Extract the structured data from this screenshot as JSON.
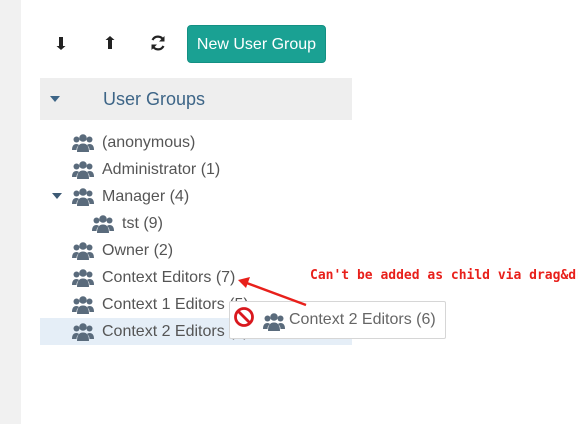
{
  "toolbar": {
    "expand_icon": "arrow-down-icon",
    "collapse_icon": "arrow-up-icon",
    "refresh_icon": "refresh-icon",
    "new_group_label": "New User Group"
  },
  "tree": {
    "root_label": "User Groups",
    "nodes": [
      {
        "label": "(anonymous)"
      },
      {
        "label": "Administrator (1)"
      },
      {
        "label": "Manager (4)"
      },
      {
        "label": "tst (9)"
      },
      {
        "label": "Owner (2)"
      },
      {
        "label": "Context Editors (7)"
      },
      {
        "label": "Context 1 Editors (5)"
      },
      {
        "label": "Context 2 Editors (6)"
      }
    ]
  },
  "drag": {
    "ghost_label": "Context 2 Editors (6)",
    "blocked_icon": "no-entry-icon"
  },
  "annotation": {
    "text": "Can't be added as child via drag&drop"
  },
  "colors": {
    "primary": "#1aa193",
    "tree_header_bg": "#eeeeee",
    "selected_bg": "#e5eef7",
    "error": "#e8201b",
    "icon": "#5a6b7c"
  }
}
